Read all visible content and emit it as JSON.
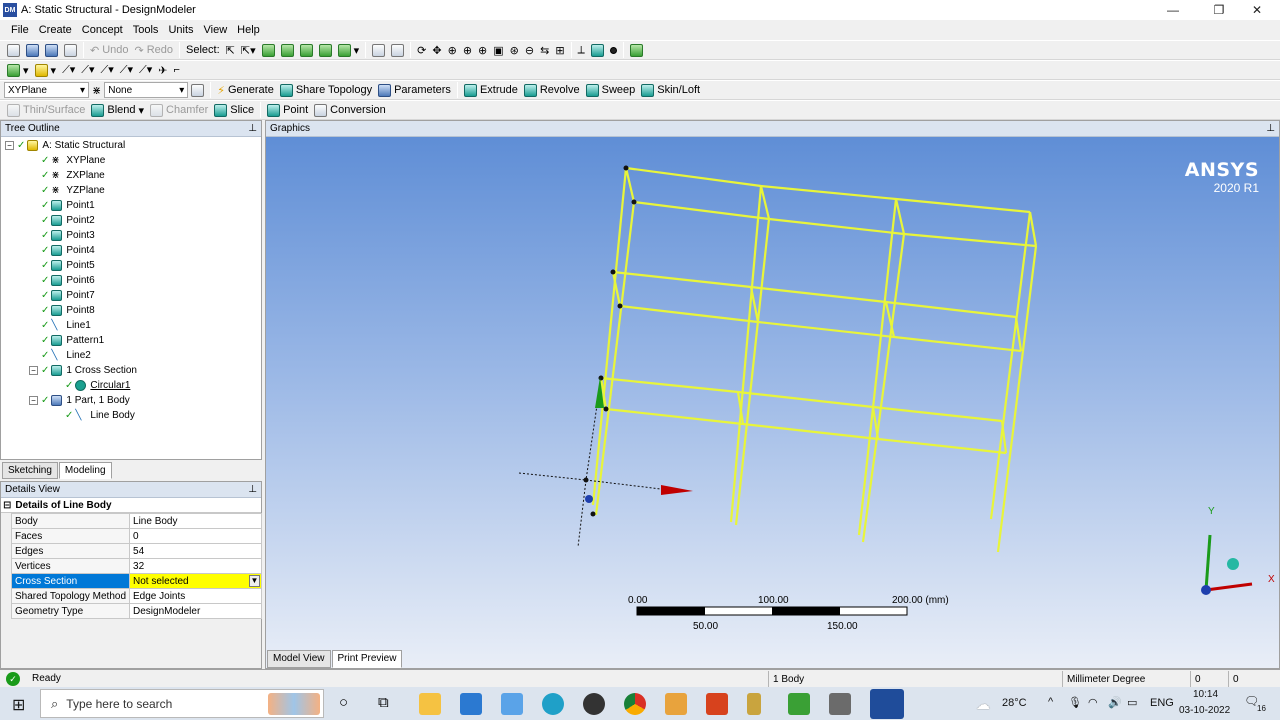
{
  "window": {
    "title": "A: Static Structural - DesignModeler",
    "app_badge": "DM",
    "minimize": "—",
    "maximize": "❐",
    "close": "✕"
  },
  "menu": [
    "File",
    "Create",
    "Concept",
    "Tools",
    "Units",
    "View",
    "Help"
  ],
  "toolbar1": {
    "undo": "Undo",
    "redo": "Redo",
    "select_label": "Select:"
  },
  "toolbar3": {
    "plane": "XYPlane",
    "sketch": "None",
    "generate": "Generate",
    "share_topology": "Share Topology",
    "parameters": "Parameters",
    "extrude": "Extrude",
    "revolve": "Revolve",
    "sweep": "Sweep",
    "skin_loft": "Skin/Loft"
  },
  "toolbar4": {
    "thin_surface": "Thin/Surface",
    "blend": "Blend",
    "chamfer": "Chamfer",
    "slice": "Slice",
    "point": "Point",
    "conversion": "Conversion"
  },
  "tree": {
    "title": "Tree Outline",
    "pin": "⊥",
    "items": [
      {
        "label": "A: Static Structural"
      },
      {
        "label": "XYPlane"
      },
      {
        "label": "ZXPlane"
      },
      {
        "label": "YZPlane"
      },
      {
        "label": "Point1"
      },
      {
        "label": "Point2"
      },
      {
        "label": "Point3"
      },
      {
        "label": "Point4"
      },
      {
        "label": "Point5"
      },
      {
        "label": "Point6"
      },
      {
        "label": "Point7"
      },
      {
        "label": "Point8"
      },
      {
        "label": "Line1"
      },
      {
        "label": "Pattern1"
      },
      {
        "label": "Line2"
      },
      {
        "label": "1 Cross Section"
      },
      {
        "label": "Circular1"
      },
      {
        "label": "1 Part, 1 Body"
      },
      {
        "label": "Line Body"
      }
    ]
  },
  "left_tabs": {
    "sketching": "Sketching",
    "modeling": "Modeling"
  },
  "details": {
    "title": "Details View",
    "group": "Details of Line Body",
    "rows": [
      {
        "key": "Body",
        "value": "Line Body"
      },
      {
        "key": "Faces",
        "value": "0"
      },
      {
        "key": "Edges",
        "value": "54"
      },
      {
        "key": "Vertices",
        "value": "32"
      },
      {
        "key": "Cross Section",
        "value": "Not selected"
      },
      {
        "key": "Shared Topology Method",
        "value": "Edge Joints"
      },
      {
        "key": "Geometry Type",
        "value": "DesignModeler"
      }
    ]
  },
  "graphics": {
    "title": "Graphics",
    "brand": "ANSYS",
    "version": "2020 R1",
    "scale": {
      "t0": "0.00",
      "t100": "100.00",
      "t200": "200.00 (mm)",
      "t50": "50.00",
      "t150": "150.00"
    },
    "triad": {
      "x": "X",
      "y": "Y"
    }
  },
  "graphics_tabs": {
    "model_view": "Model View",
    "print_preview": "Print Preview"
  },
  "status": {
    "text": "Ready",
    "bodies": "1 Body",
    "units": "Millimeter  Degree",
    "v1": "0",
    "v2": "0"
  },
  "taskbar": {
    "search_placeholder": "Type here to search",
    "weather": "28°C",
    "lang": "ENG",
    "time": "10:14",
    "date": "03-10-2022",
    "notif": "16"
  },
  "colors": {
    "frame": "#e8f53a",
    "select_bg": "#0078d7",
    "warn_field": "#ffff00"
  }
}
